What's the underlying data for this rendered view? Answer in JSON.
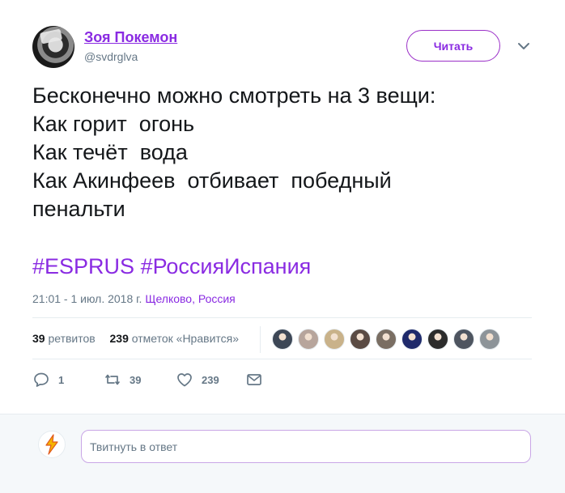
{
  "author": {
    "name": "Зоя Покемон",
    "handle": "@svdrglva"
  },
  "follow_button": "Читать",
  "tweet": {
    "text": "Бесконечно можно смотреть на 3 вещи:\nКак горит  огонь\nКак течёт  вода\nКак Акинфеев  отбивает  победный\nпенальти",
    "hashtags": [
      "#ESPRUS",
      "#РоссияИспания"
    ],
    "time": "21:01 - 1 июл. 2018 г.",
    "location": "Щелково, Россия"
  },
  "stats": {
    "retweets_count": "39",
    "retweets_label": "ретвитов",
    "likes_count": "239",
    "likes_label": "отметок «Нравится»"
  },
  "likers": [
    {
      "icon": "avatar-icon",
      "color": "#3d4756"
    },
    {
      "icon": "avatar-icon",
      "color": "#b7a59c"
    },
    {
      "icon": "avatar-icon",
      "color": "#c9b28a"
    },
    {
      "icon": "avatar-icon",
      "color": "#5a4b44"
    },
    {
      "icon": "avatar-icon",
      "color": "#7a6e63"
    },
    {
      "icon": "avatar-icon",
      "color": "#1f2a6b"
    },
    {
      "icon": "avatar-icon",
      "color": "#2c2c2c"
    },
    {
      "icon": "avatar-icon",
      "color": "#4e5560"
    },
    {
      "icon": "avatar-icon",
      "color": "#8d9499"
    }
  ],
  "actions": {
    "reply_count": "1",
    "retweet_count": "39",
    "like_count": "239"
  },
  "reply": {
    "placeholder": "Твитнуть в ответ"
  },
  "colors": {
    "accent": "#8a2be2",
    "secondary_text": "#657786",
    "divider": "#e6ecf0"
  }
}
